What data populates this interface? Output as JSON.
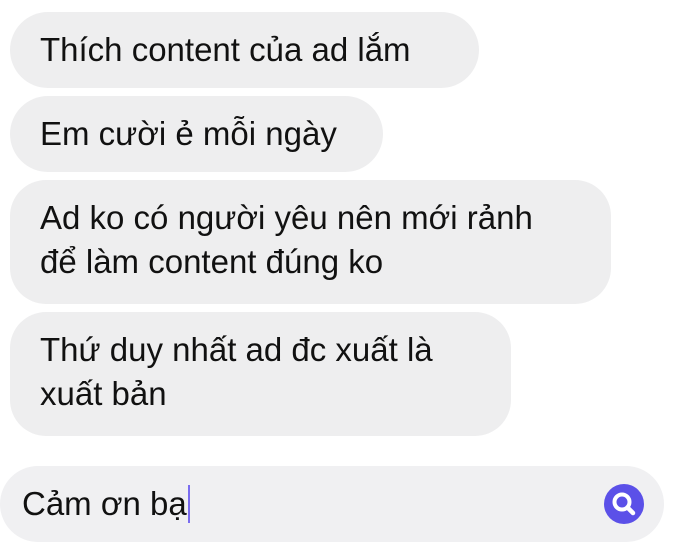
{
  "messages": [
    {
      "lines": [
        "Thích content của ad lắm"
      ]
    },
    {
      "lines": [
        "Em cười ẻ mỗi ngày"
      ]
    },
    {
      "lines": [
        "Ad ko có người yêu nên mới rảnh",
        "để làm content đúng ko"
      ]
    },
    {
      "lines": [
        "Thứ duy nhất ad đc xuất là",
        "xuất bản"
      ]
    }
  ],
  "composer": {
    "value": "Cảm ơn bạ",
    "action_icon": "search-icon"
  },
  "colors": {
    "bubble_bg": "#eeeeef",
    "composer_bg": "#f0f0f2",
    "accent": "#5b50e8",
    "text": "#111111"
  }
}
